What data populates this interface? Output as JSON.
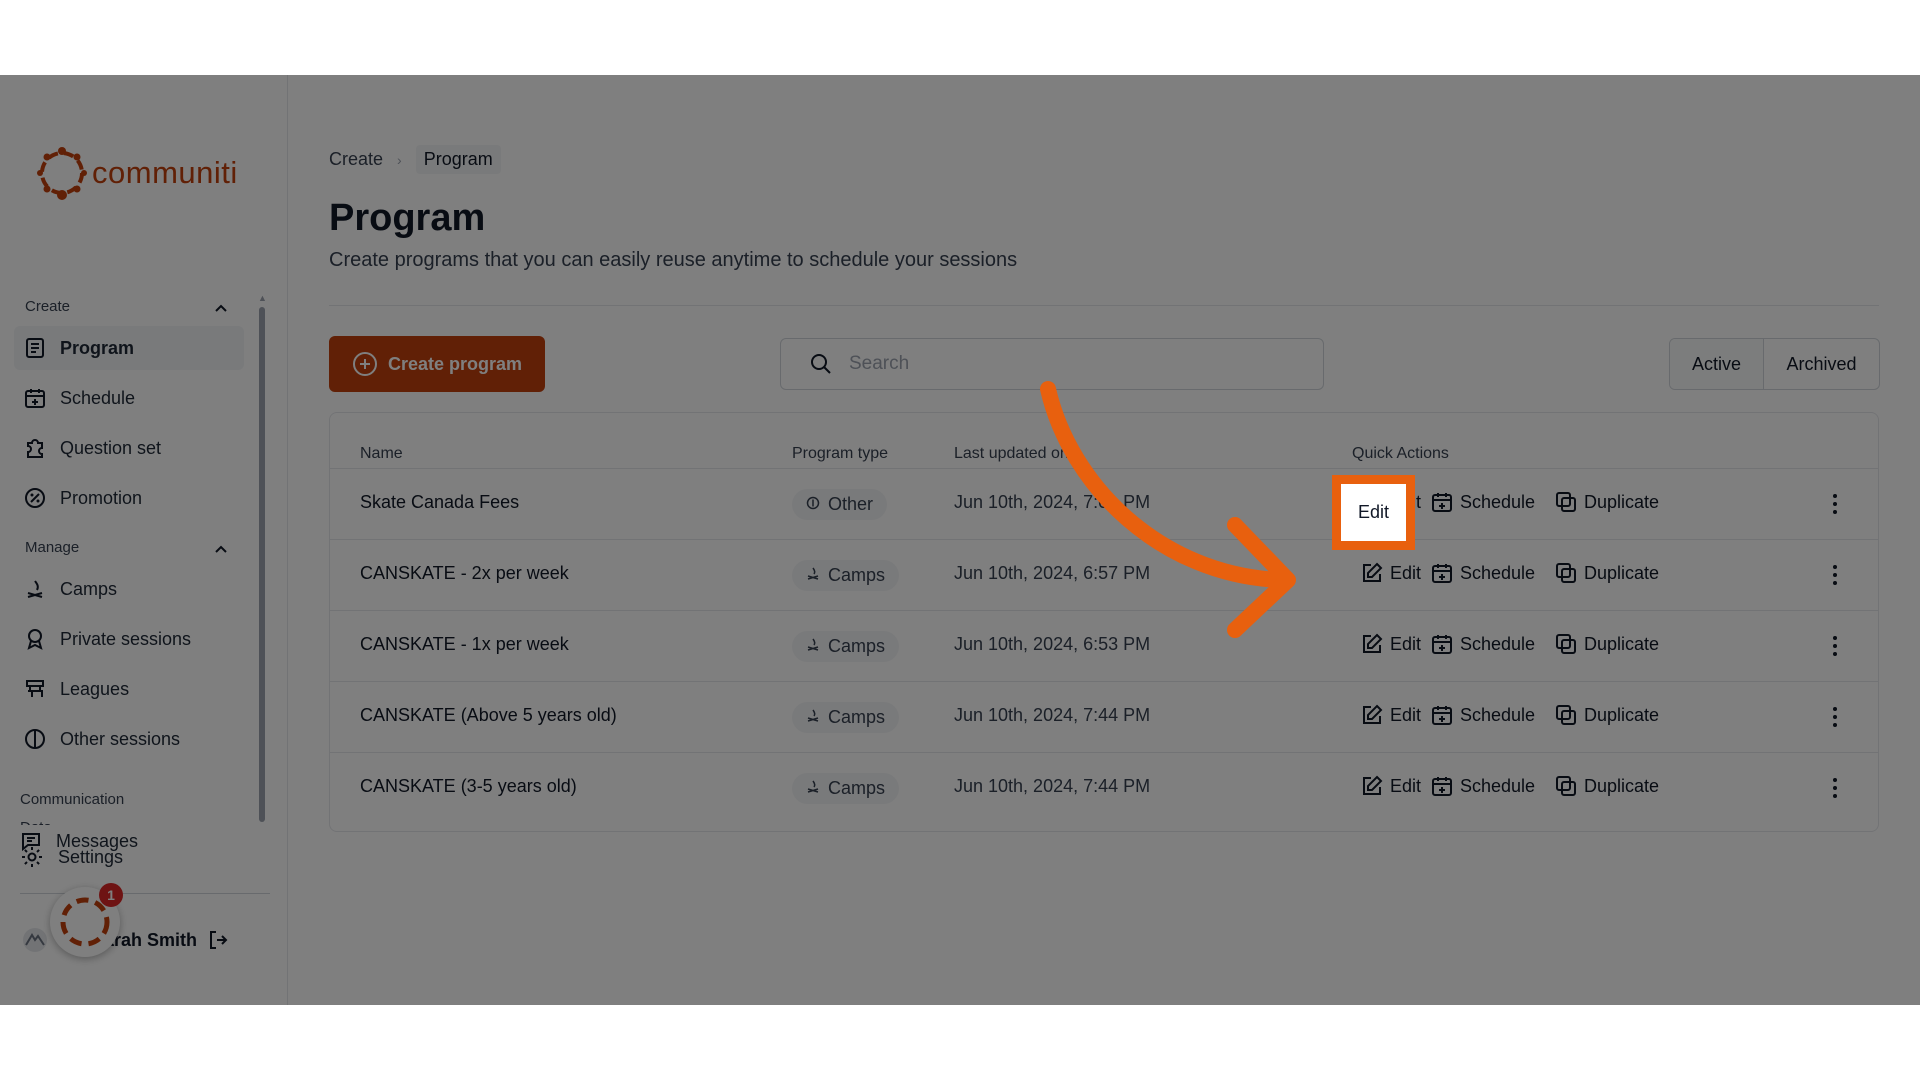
{
  "sidebar": {
    "brand": "communiti",
    "sections": {
      "create": "Create",
      "manage": "Manage",
      "communication": "Communication",
      "data": "Data"
    },
    "create_items": [
      {
        "label": "Program",
        "icon": "document-icon",
        "active": true
      },
      {
        "label": "Schedule",
        "icon": "calendar-plus-icon"
      },
      {
        "label": "Question set",
        "icon": "puzzle-icon"
      },
      {
        "label": "Promotion",
        "icon": "percent-badge-icon"
      }
    ],
    "manage_items": [
      {
        "label": "Camps",
        "icon": "campfire-icon"
      },
      {
        "label": "Private sessions",
        "icon": "award-icon"
      },
      {
        "label": "Leagues",
        "icon": "bracket-icon"
      },
      {
        "label": "Other sessions",
        "icon": "half-circle-icon"
      }
    ],
    "communication_items": [
      {
        "label": "Messages",
        "icon": "message-icon"
      }
    ],
    "settings_label": "Settings",
    "user_name": "Sarah Smith",
    "notification_count": "1"
  },
  "breadcrumb": {
    "items": [
      "Create",
      "Program"
    ]
  },
  "page": {
    "title": "Program",
    "subtitle": "Create programs that you can easily reuse anytime to schedule your sessions"
  },
  "toolbar": {
    "create_label": "Create program",
    "search_placeholder": "Search",
    "filter_active": "Active",
    "filter_archived": "Archived"
  },
  "table": {
    "headers": {
      "name": "Name",
      "type": "Program type",
      "updated": "Last updated on",
      "actions": "Quick Actions"
    },
    "action_labels": {
      "edit": "Edit",
      "schedule": "Schedule",
      "duplicate": "Duplicate"
    },
    "rows": [
      {
        "name": "Skate Canada Fees",
        "type": "Other",
        "updated": "Jun 10th, 2024, 7:01 PM"
      },
      {
        "name": "CANSKATE - 2x per week",
        "type": "Camps",
        "updated": "Jun 10th, 2024, 6:57 PM"
      },
      {
        "name": "CANSKATE - 1x per week",
        "type": "Camps",
        "updated": "Jun 10th, 2024, 6:53 PM"
      },
      {
        "name": "CANSKATE (Above 5 years old)",
        "type": "Camps",
        "updated": "Jun 10th, 2024, 7:44 PM"
      },
      {
        "name": "CANSKATE (3-5 years old)",
        "type": "Camps",
        "updated": "Jun 10th, 2024, 7:44 PM"
      }
    ]
  },
  "overlay": {
    "highlight_label": "Edit",
    "accent_color": "#e8600e"
  },
  "colors": {
    "brand": "#c2410c"
  }
}
